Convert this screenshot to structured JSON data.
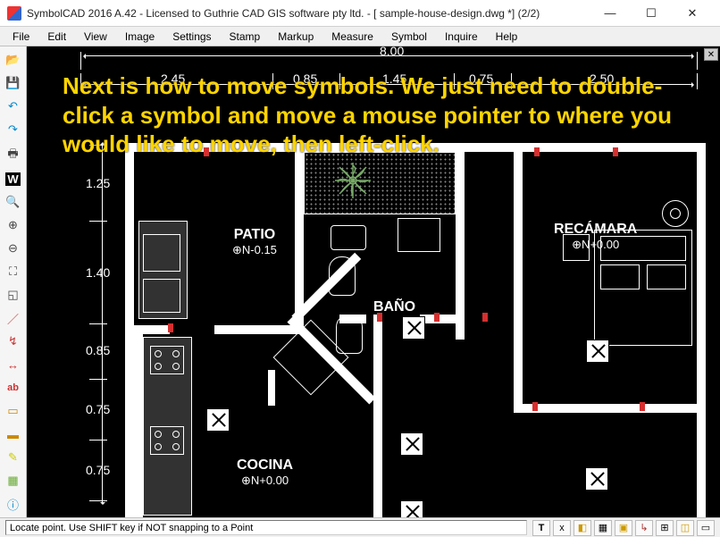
{
  "window": {
    "title": "SymbolCAD 2016 A.42 - Licensed to Guthrie CAD GIS software pty ltd. -  [ sample-house-design.dwg *] (2/2)"
  },
  "menu": [
    "File",
    "Edit",
    "View",
    "Image",
    "Settings",
    "Stamp",
    "Markup",
    "Measure",
    "Symbol",
    "Inquire",
    "Help"
  ],
  "toolbar_icons": [
    "open",
    "save",
    "undo",
    "redo",
    "print",
    "text",
    "magnifier",
    "zoom-in",
    "zoom-out",
    "zoom-extents",
    "zoom-window",
    "line",
    "polyline",
    "dimension",
    "label-ab",
    "rect",
    "erase",
    "highlight",
    "hatch",
    "info"
  ],
  "overlay_instruction": "Next is how to move symbols. We just need to double-click a symbol and move a mouse pointer to where you would like to move, then left-click.",
  "dimensions": {
    "top_total": "8.00",
    "top_segs": [
      "2.45",
      "0.85",
      "1.45",
      "0.75",
      "2.50"
    ],
    "left_segs": [
      "1.25",
      "1.40",
      "0.85",
      "0.75",
      "0.75"
    ]
  },
  "rooms": {
    "patio": {
      "name": "PATIO",
      "level": "⊕N-0.15"
    },
    "bano": {
      "name": "BAÑO"
    },
    "recamara": {
      "name": "RECÁMARA",
      "level": "⊕N+0.00"
    },
    "cocina": {
      "name": "COCINA",
      "level": "⊕N+0.00"
    }
  },
  "status": {
    "message": "Locate point. Use SHIFT key if NOT snapping to a Point"
  },
  "status_icons": [
    "T",
    "x",
    "layers",
    "grid",
    "snap",
    "ortho",
    "polar",
    "dyn",
    "track"
  ]
}
